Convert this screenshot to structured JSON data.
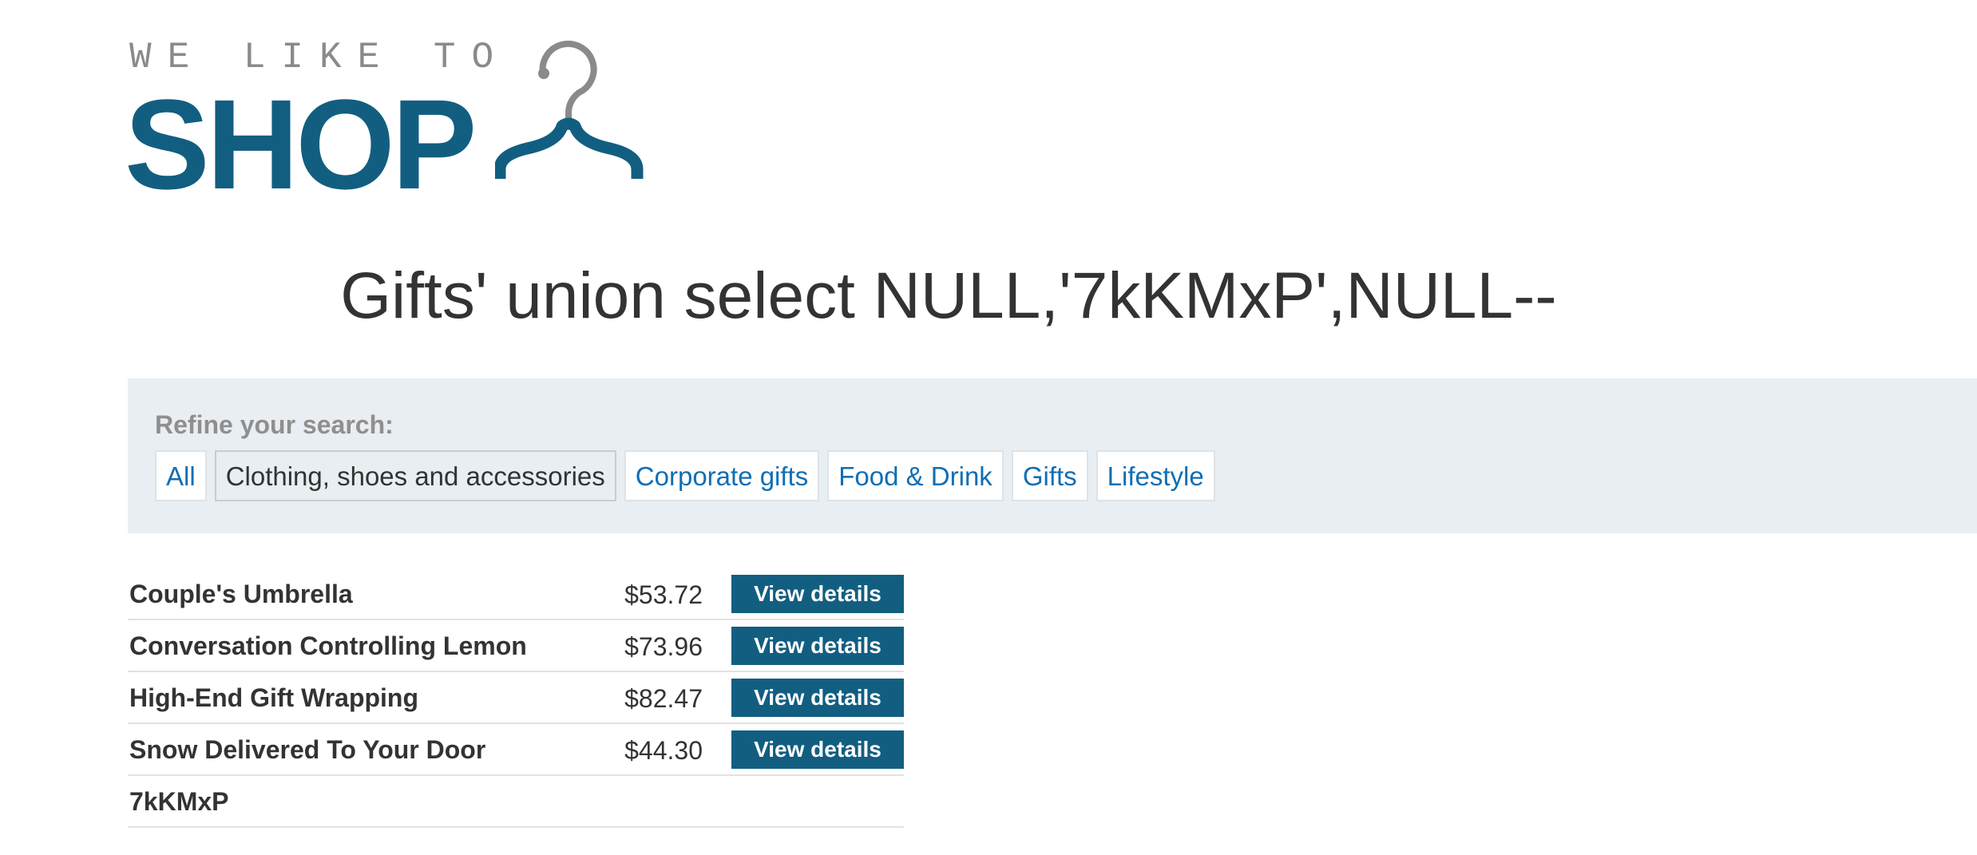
{
  "brand": {
    "tagline": "WE LIKE TO",
    "word": "SHOP",
    "color": "#125e81"
  },
  "heading": "Gifts' union select NULL,'7kKMxP',NULL--",
  "filters": {
    "label": "Refine your search:",
    "items": [
      {
        "label": "All",
        "active": false
      },
      {
        "label": "Clothing, shoes and accessories",
        "active": true
      },
      {
        "label": "Corporate gifts",
        "active": false
      },
      {
        "label": "Food & Drink",
        "active": false
      },
      {
        "label": "Gifts",
        "active": false
      },
      {
        "label": "Lifestyle",
        "active": false
      }
    ]
  },
  "products": [
    {
      "name": "Couple's Umbrella",
      "price": "$53.72",
      "button": "View details"
    },
    {
      "name": "Conversation Controlling Lemon",
      "price": "$73.96",
      "button": "View details"
    },
    {
      "name": "High-End Gift Wrapping",
      "price": "$82.47",
      "button": "View details"
    },
    {
      "name": "Snow Delivered To Your Door",
      "price": "$44.30",
      "button": "View details"
    },
    {
      "name": "7kKMxP",
      "price": "",
      "button": ""
    }
  ]
}
